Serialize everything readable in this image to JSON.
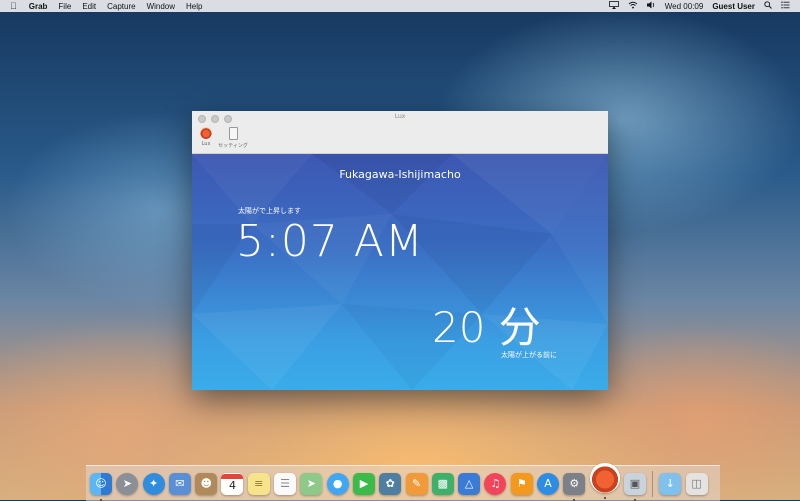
{
  "menubar": {
    "app": "Grab",
    "items": [
      "File",
      "Edit",
      "Capture",
      "Window",
      "Help"
    ],
    "clock": "Wed 00:09",
    "user": "Guest User"
  },
  "window": {
    "title": "Lux",
    "toolbar": {
      "lux_label": "Lux",
      "settings_label": "セッティング"
    },
    "location": "Fukagawa-Ishijimacho",
    "sunrise_label": "太陽がで上昇します",
    "sunrise_time": "5:07 AM",
    "minutes_value": "20 分",
    "minutes_label": "太陽が上がる前に"
  },
  "dock": {
    "calendar_day": "4",
    "apps": [
      "Finder",
      "Launchpad",
      "Safari",
      "Mail",
      "Contacts",
      "Calendar",
      "Notes",
      "Reminders",
      "Maps",
      "Messages",
      "FaceTime",
      "Photos",
      "Pages",
      "Numbers",
      "Keynote",
      "iTunes",
      "iBooks",
      "App Store",
      "System Preferences",
      "Lux",
      "Preview",
      "Downloads",
      "Trash"
    ]
  },
  "colors": {
    "content_top": "#3d57b2",
    "content_bottom": "#3aace9",
    "lux_icon": "#f06232"
  }
}
